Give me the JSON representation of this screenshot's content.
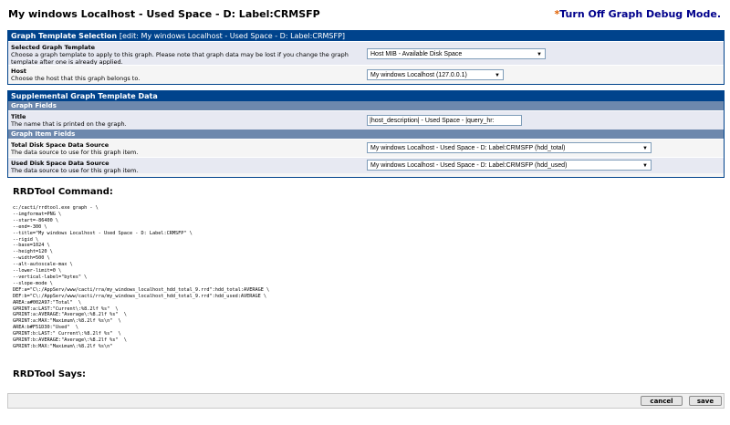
{
  "header": {
    "title": "My windows Localhost - Used Space - D: Label:CRMSFP",
    "debug_star": "*",
    "debug_link": "Turn Off Graph Debug Mode."
  },
  "template_panel": {
    "title": "Graph Template Selection",
    "edit_note": "[edit: My windows Localhost - Used Space - D: Label:CRMSFP]",
    "selected_label": "Selected Graph Template",
    "selected_desc": "Choose a graph template to apply to this graph. Please note that graph data may be lost if you change the graph template after one is already applied.",
    "selected_value": "Host MIB - Available Disk Space",
    "host_label": "Host",
    "host_desc": "Choose the host that this graph belongs to.",
    "host_value": "My windows Localhost (127.0.0.1)"
  },
  "supplemental_panel": {
    "title": "Supplemental Graph Template Data",
    "graph_fields": "Graph Fields",
    "title_label": "Title",
    "title_desc": "The name that is printed on the graph.",
    "title_value": "|host_description| - Used Space - |query_hr:",
    "item_fields": "Graph Item Fields",
    "total_label": "Total Disk Space Data Source",
    "total_desc": "The data source to use for this graph item.",
    "total_value": "My windows Localhost - Used Space - D: Label:CRMSFP (hdd_total)",
    "used_label": "Used Disk Space Data Source",
    "used_desc": "The data source to use for this graph item.",
    "used_value": "My windows Localhost - Used Space - D: Label:CRMSFP (hdd_used)"
  },
  "rrd": {
    "command_title": "RRDTool Command:",
    "says_title": "RRDTool Says:",
    "lines": [
      "c:/cacti/rrdtool.exe graph - \\",
      "--imgformat=PNG \\",
      "--start=-86400 \\",
      "--end=-300 \\",
      "--title=\"My windows Localhost - Used Space - D: Label:CRMSFP\" \\",
      "--rigid \\",
      "--base=1024 \\",
      "--height=120 \\",
      "--width=500 \\",
      "--alt-autoscale-max \\",
      "--lower-limit=0 \\",
      "--vertical-label=\"bytes\" \\",
      "--slope-mode \\",
      "DEF:a=\"C\\:/AppServ/www/cacti/rra/my_windows_localhost_hdd_total_9.rrd\":hdd_total:AVERAGE \\",
      "DEF:b=\"C\\:/AppServ/www/cacti/rra/my_windows_localhost_hdd_total_9.rrd\":hdd_used:AVERAGE \\",
      "AREA:a#002A97:\"Total\"  \\",
      "GPRINT:a:LAST:\"Current\\:%8.2lf %s\"  \\",
      "GPRINT:a:AVERAGE:\"Average\\:%8.2lf %s\"  \\",
      "GPRINT:a:MAX:\"Maximum\\:%8.2lf %s\\n\"  \\",
      "AREA:b#F51D30:\"Used\"  \\",
      "GPRINT:b:LAST:\" Current\\:%8.2lf %s\"  \\",
      "GPRINT:b:AVERAGE:\"Average\\:%8.2lf %s\"  \\",
      "GPRINT:b:MAX:\"Maximum\\:%8.2lf %s\\n\""
    ]
  },
  "footer": {
    "cancel": "cancel",
    "save": "save"
  },
  "colors": {
    "panel_header": "#00438c",
    "section_header": "#6d88ad",
    "row_alt": "#e7e9f2",
    "link": "#00008b"
  },
  "icons": {
    "dropdown": "chevron-down-icon"
  }
}
